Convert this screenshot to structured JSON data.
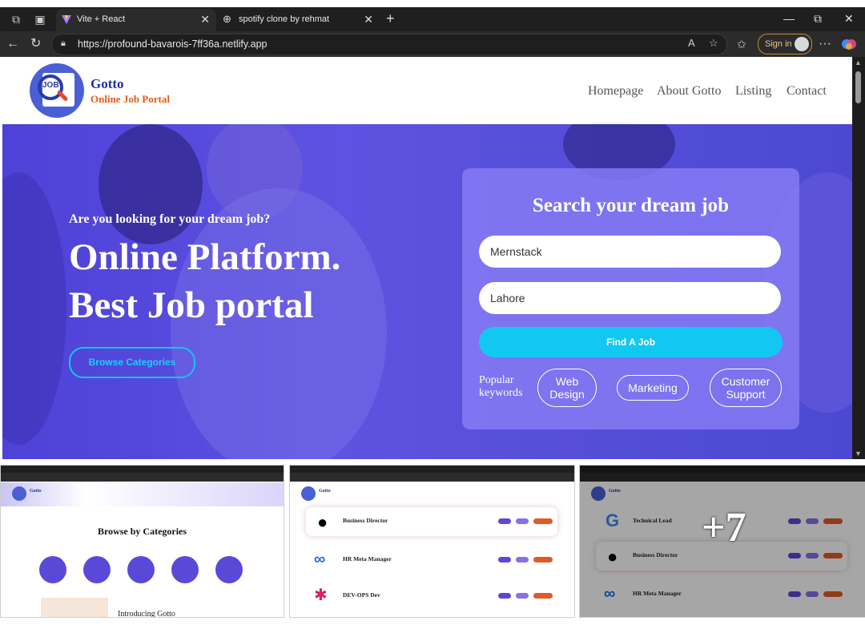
{
  "browser": {
    "tabs": [
      {
        "label": "Vite + React",
        "active": true
      },
      {
        "label": "spotify clone by rehmat",
        "active": false
      }
    ],
    "url": "https://profound-bavarois-7ff36a.netlify.app",
    "signin_label": "Sign in"
  },
  "header": {
    "logo_text": "JOB",
    "brand_name": "Gotto",
    "brand_sub": "Online Job Portal",
    "menu": [
      "Homepage",
      "About Gotto",
      "Listing",
      "Contact"
    ]
  },
  "hero": {
    "question": "Are you looking for your dream job?",
    "headline_1": "Online Platform.",
    "headline_2": "Best Job portal",
    "browse_button": "Browse Categories"
  },
  "search": {
    "title": "Search your dream job",
    "keyword_value": "Mernstack",
    "location_value": "Lahore",
    "find_button": "Find A Job",
    "popular_label": "Popular keywords",
    "keywords": [
      "Web Design",
      "Marketing",
      "Customer Support"
    ]
  },
  "thumbnails": {
    "t1": {
      "brand": "Gotto",
      "heading": "Browse by Categories",
      "intro": "Introducing Gotto"
    },
    "t2": {
      "brand": "Gotto",
      "jobs": [
        "Business Director",
        "HR Meta Manager",
        "DEV-OPS Dev"
      ]
    },
    "t3": {
      "brand": "Gotto",
      "jobs": [
        "Technical Lead",
        "Business Director",
        "HR Meta Manager"
      ],
      "more_count": "+7"
    }
  },
  "colors": {
    "accent": "#12c8f2",
    "brand_blue": "#1b2ea8",
    "brand_orange": "#e55a1b",
    "hero_overlay": "#5a53d8"
  }
}
